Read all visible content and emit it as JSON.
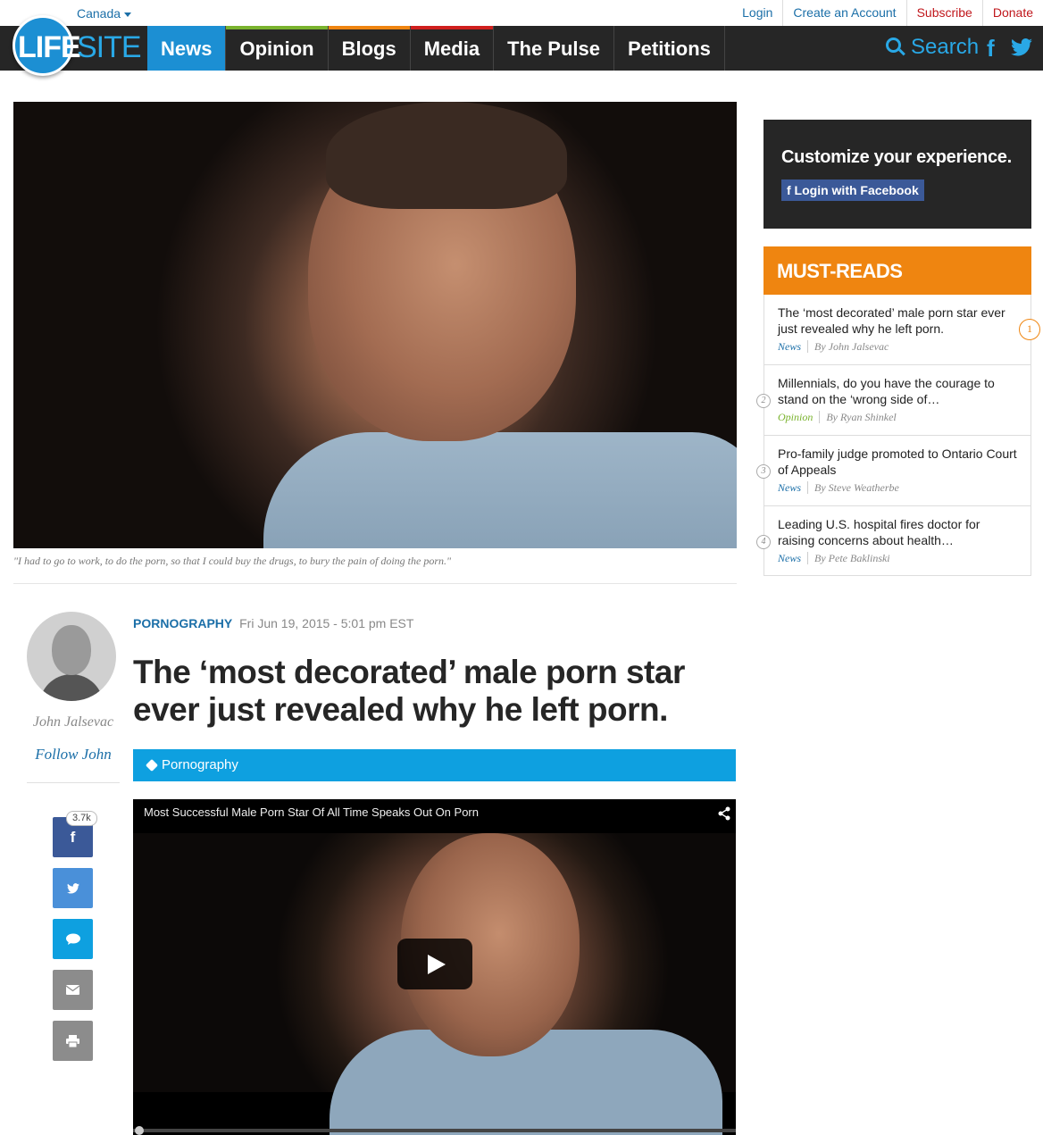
{
  "topbar": {
    "region": "Canada",
    "links": [
      {
        "label": "Login",
        "color": "#1b6fa8"
      },
      {
        "label": "Create an Account",
        "color": "#1b6fa8"
      },
      {
        "label": "Subscribe",
        "color": "#c0171c"
      },
      {
        "label": "Donate",
        "color": "#c0171c"
      }
    ]
  },
  "nav": {
    "logo_left": "LIFE",
    "logo_right": "SITE",
    "tabs": [
      {
        "label": "News",
        "accent": "#1c8fd3",
        "active": true
      },
      {
        "label": "Opinion",
        "accent": "#7ab32e"
      },
      {
        "label": "Blogs",
        "accent": "#ef8510"
      },
      {
        "label": "Media",
        "accent": "#d0201e"
      },
      {
        "label": "The Pulse",
        "accent": "#262626"
      },
      {
        "label": "Petitions",
        "accent": "#262626"
      }
    ],
    "search_label": "Search",
    "icons": [
      "search-icon",
      "facebook-icon",
      "twitter-icon"
    ]
  },
  "hero": {
    "caption": "\"I had to go to work, to do the porn, so that I could buy the drugs, to bury the pain of doing the porn.\""
  },
  "author": {
    "name": "John Jalsevac",
    "follow": "Follow John"
  },
  "share": {
    "count": "3.7k",
    "buttons": [
      {
        "icon": "facebook-icon",
        "glyph": "f",
        "color": "#3b5998"
      },
      {
        "icon": "twitter-icon",
        "glyph": "",
        "color": "#4a90d9"
      },
      {
        "icon": "comment-icon",
        "glyph": "",
        "color": "#0ea0e0"
      },
      {
        "icon": "email-icon",
        "glyph": "",
        "color": "#8c8c8c"
      },
      {
        "icon": "print-icon",
        "glyph": "",
        "color": "#8c8c8c"
      }
    ]
  },
  "article": {
    "category": "PORNOGRAPHY",
    "date": "Fri Jun 19, 2015 - 5:01 pm EST",
    "headline": "The ‘most decorated’ male porn star ever just revealed why he left porn.",
    "tag": "Pornography"
  },
  "video": {
    "title": "Most Successful Male Porn Star Of All Time Speaks Out On Porn",
    "progress": 0
  },
  "sidebar": {
    "customize": {
      "heading": "Customize your experience.",
      "button": "f Login with Facebook"
    },
    "must_reads": {
      "heading": "MUST-READS",
      "items": [
        {
          "rank": "1",
          "title": "The ‘most decorated’ male porn star ever just revealed why he left porn.",
          "section": "News",
          "section_color": "#1b6fa8",
          "byline": "By John Jalsevac"
        },
        {
          "rank": "2",
          "title": "Millennials, do you have the courage to stand on the ‘wrong side of…",
          "section": "Opinion",
          "section_color": "#7ab32e",
          "byline": "By Ryan Shinkel"
        },
        {
          "rank": "3",
          "title": "Pro-family judge promoted to Ontario Court of Appeals",
          "section": "News",
          "section_color": "#1b6fa8",
          "byline": "By Steve Weatherbe"
        },
        {
          "rank": "4",
          "title": "Leading U.S. hospital fires doctor for raising concerns about health…",
          "section": "News",
          "section_color": "#1b6fa8",
          "byline": "By Pete Baklinski"
        }
      ]
    }
  }
}
